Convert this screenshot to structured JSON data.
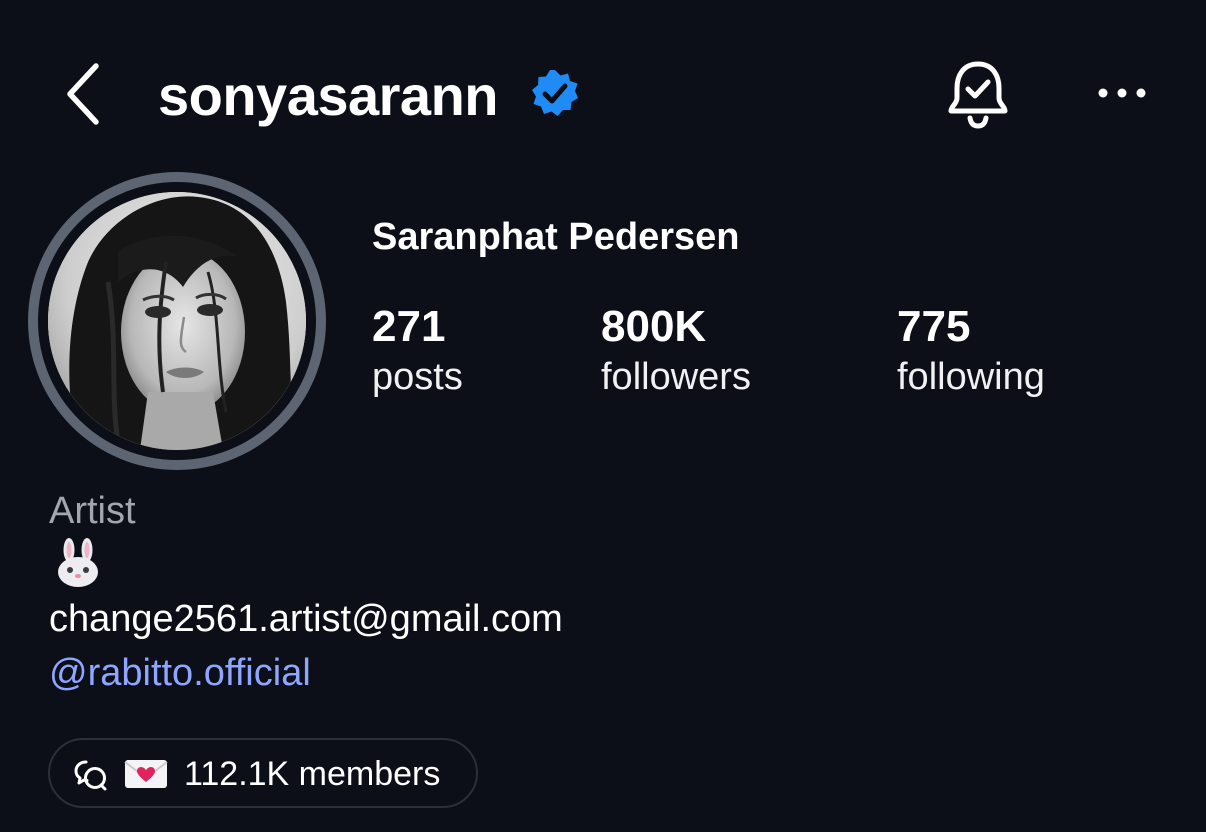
{
  "header": {
    "username": "sonyasarann",
    "icons": {
      "back": "chevron-left-icon",
      "verified": "verified-badge-icon",
      "notifications": "bell-check-icon",
      "more": "more-horizontal-icon"
    }
  },
  "profile": {
    "full_name": "Saranphat Pedersen",
    "stats": [
      {
        "value": "271",
        "label": "posts"
      },
      {
        "value": "800K",
        "label": "followers"
      },
      {
        "value": "775",
        "label": "following"
      }
    ],
    "bio": {
      "category": "Artist",
      "emoji": "rabbit-face-icon",
      "email": "change2561.artist@gmail.com",
      "mention": "@rabitto.official"
    },
    "channel": {
      "members": "112.1K members",
      "icons": [
        "broadcast-channel-icon",
        "love-letter-icon"
      ]
    }
  },
  "colors": {
    "background": "#0c0f17",
    "verified": "#1f8bf5",
    "link": "#8ea6ff",
    "muted": "#a2a6ae"
  }
}
